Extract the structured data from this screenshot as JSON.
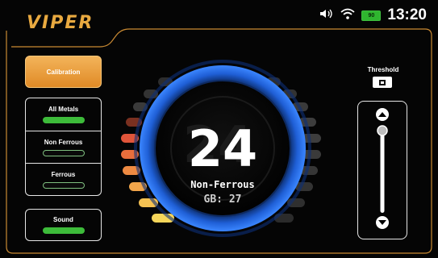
{
  "brand": {
    "logo": "VIPER"
  },
  "status": {
    "battery": "90",
    "time": "13:20",
    "icons": [
      "speaker-icon",
      "wifi-icon",
      "battery-icon"
    ]
  },
  "sidebar": {
    "calibration_label": "Calibration",
    "modes": [
      {
        "label": "All Metals",
        "active": true
      },
      {
        "label": "Non Ferrous",
        "active": false
      },
      {
        "label": "Ferrous",
        "active": false
      }
    ],
    "sound_label": "Sound",
    "sound_on": true
  },
  "gauge": {
    "target_id": "24",
    "target_type": "Non-Ferrous",
    "gb": "GB: 27"
  },
  "threshold": {
    "label": "Threshold"
  },
  "colors": {
    "accent": "#e8a940",
    "active_green": "#3dbb3a",
    "ring_blue": "#1f5fd6"
  }
}
